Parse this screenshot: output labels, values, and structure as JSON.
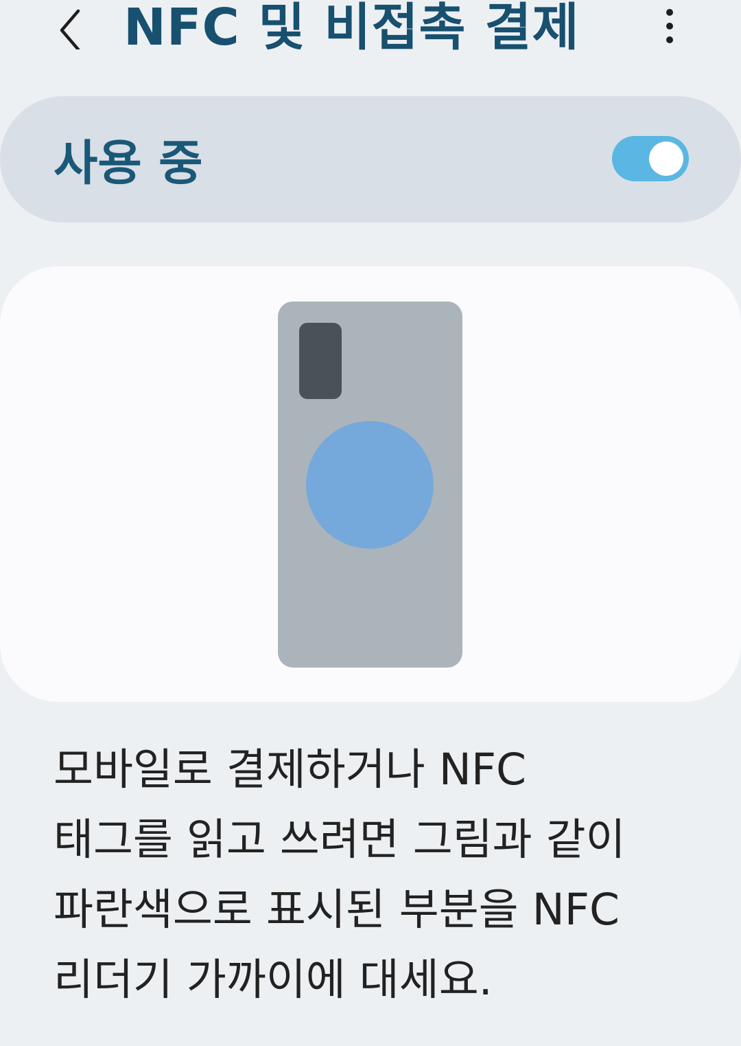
{
  "app_bar": {
    "title": "NFC 및 비접촉 결제",
    "back_icon": "chevron-left-icon",
    "more_icon": "more-vertical-icon"
  },
  "toggle": {
    "label": "사용 중",
    "state": "on",
    "accent_color": "#5ab6e2"
  },
  "illustration": {
    "nfc_area_color": "#76a9db",
    "phone_color": "#acb4bb"
  },
  "description": "모바일로 결제하거나 NFC 태그를 읽고 쓰려면 그림과 같이 파란색으로 표시된 부분을 NFC 리더기 가까이에 대세요."
}
